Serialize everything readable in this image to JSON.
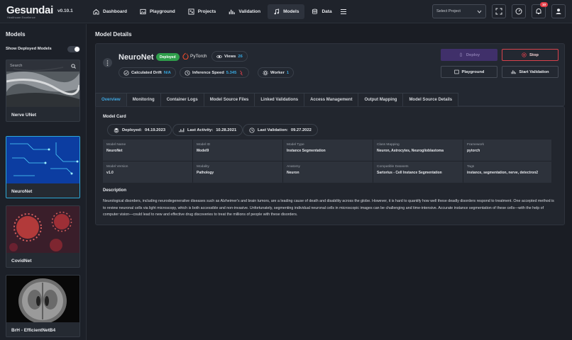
{
  "app": {
    "logo": "Gesundai",
    "logo_sub": "Healthcare Excellence",
    "version": "v0.10.1"
  },
  "nav": [
    {
      "label": "Dashboard",
      "icon": "home-icon"
    },
    {
      "label": "Playground",
      "icon": "image-icon"
    },
    {
      "label": "Projects",
      "icon": "projects-icon"
    },
    {
      "label": "Validation",
      "icon": "bar-chart-icon"
    },
    {
      "label": "Models",
      "icon": "music-note-icon",
      "active": true
    },
    {
      "label": "Data",
      "icon": "database-icon"
    }
  ],
  "topright": {
    "select_placeholder": "Select Project",
    "notification_count": "10"
  },
  "sidebar": {
    "title": "Models",
    "toggle_label": "Show Deployed Models",
    "search_placeholder": "Search",
    "models": [
      {
        "name": "Nerve UNet"
      },
      {
        "name": "NeuroNet",
        "selected": true
      },
      {
        "name": "CovidNet"
      },
      {
        "name": "BrH - EfficientNetB4"
      }
    ]
  },
  "main": {
    "page_title": "Model Details",
    "model": {
      "name": "NeuroNet",
      "status": "Deployed",
      "framework": "PyTorch",
      "views_label": "Views",
      "views": "26",
      "drift_label": "Calculated Drift",
      "drift": "N/A",
      "speed_label": "Inference Speed",
      "speed": "5.345",
      "worker_label": "Worker",
      "worker": "1"
    },
    "buttons": {
      "deploy": "Deploy",
      "stop": "Stop",
      "playground": "Playground",
      "start_validation": "Start Validation"
    },
    "tabs": [
      "Overview",
      "Monitoring",
      "Container Logs",
      "Model Source Files",
      "Linked Validations",
      "Access Management",
      "Output Mapping",
      "Model Source Details"
    ],
    "model_card": {
      "title": "Model Card",
      "deployed_label": "Deployed:",
      "deployed": "04.19.2023",
      "activity_label": "Last Activity:",
      "activity": "10.28.2021",
      "validation_label": "Last Validation:",
      "validation": "09.27.2022",
      "fields": [
        {
          "label": "Model Name",
          "value": "NeuroNet"
        },
        {
          "label": "Model ID",
          "value": "Model9"
        },
        {
          "label": "Model Type",
          "value": "Instance Segmentation"
        },
        {
          "label": "Class Mapping",
          "value": "Neuron, Astrocytes, Neuroglioblastoma"
        },
        {
          "label": "Framework",
          "value": "pytorch"
        },
        {
          "label": "Model Version",
          "value": "v1.0"
        },
        {
          "label": "Modality",
          "value": "Pathology"
        },
        {
          "label": "Anatomy",
          "value": "Neuron"
        },
        {
          "label": "Compatible Datasets",
          "value": "Sartorius - Cell Instance Segmentation"
        },
        {
          "label": "Tags",
          "value": "instance, segmentation, nerve, detectron2"
        }
      ],
      "description_title": "Description",
      "description": "Neurological disorders, including neurodegenerative diseases such as Alzheimer's and brain tumors, are a leading cause of death and disability across the globe. However, it is hard to quantify how well these deadly disorders respond to treatment. One accepted method is to review neuronal cells via light microscopy, which is both accessible and non-invasive. Unfortunately, segmenting individual neuronal cells in microscopic images can be challenging and time-intensive. Accurate instance segmentation of these cells—with the help of computer vision—could lead to new and effective drug discoveries to treat the millions of people with these disorders."
    }
  }
}
